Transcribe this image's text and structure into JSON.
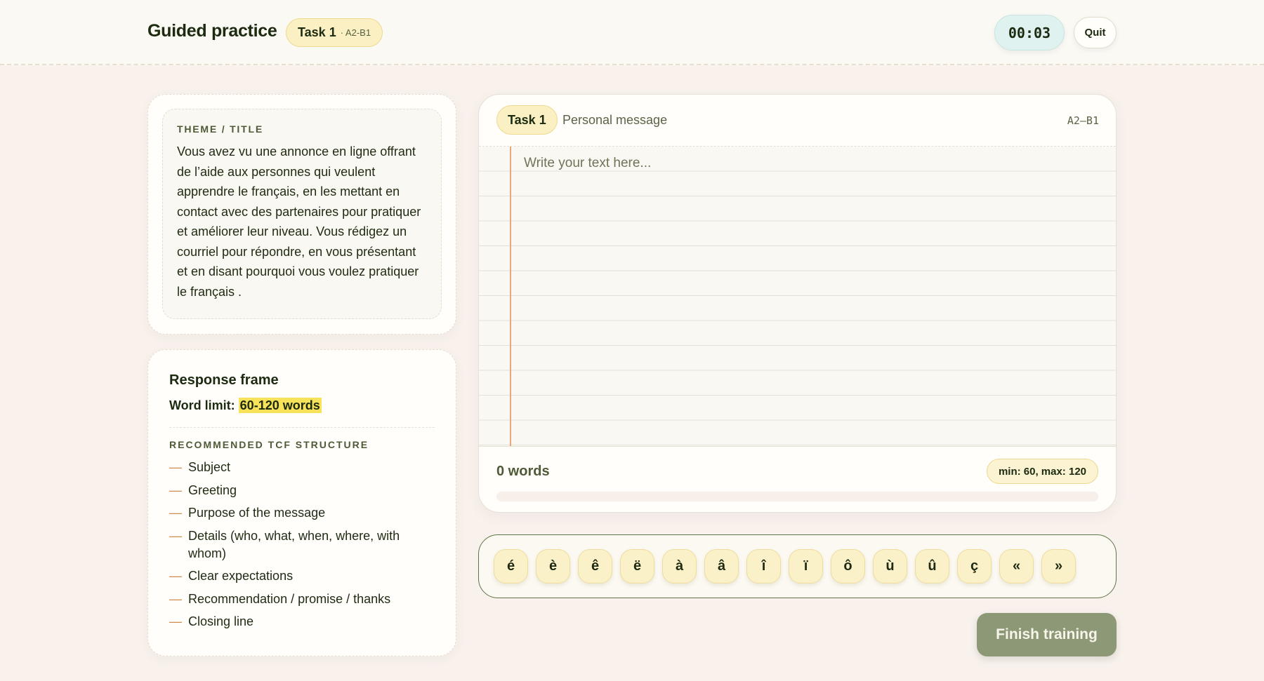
{
  "header": {
    "title": "Guided practice",
    "task_label": "Task 1",
    "level_label": "· A2-B1",
    "timer": "00:03",
    "quit_label": "Quit"
  },
  "theme": {
    "label": "THEME / TITLE",
    "text": "Vous avez vu une annonce en ligne offrant de l’aide aux personnes qui veulent apprendre le français, en les mettant en contact avec des partenaires pour pratiquer et améliorer leur niveau. Vous rédigez un courriel pour répondre, en vous présentant et en disant pourquoi vous voulez pratiquer le français ."
  },
  "frame": {
    "title": "Response frame",
    "limit_label": "Word limit:",
    "limit_value": "60-120 words",
    "structure_label": "RECOMMENDED TCF STRUCTURE",
    "dash": "—",
    "items": [
      "Subject",
      "Greeting",
      "Purpose of the message",
      "Details (who, what, when, where, with whom)",
      "Clear expectations",
      "Recommendation / promise / thanks",
      "Closing line"
    ]
  },
  "editor": {
    "task_label": "Task 1",
    "subtitle": "Personal message",
    "level": "A2–B1",
    "placeholder": "Write your text here...",
    "word_count": "0 words",
    "minmax": "min: 60, max: 120",
    "progress": 0
  },
  "accents": [
    "é",
    "è",
    "ê",
    "ë",
    "à",
    "â",
    "î",
    "ï",
    "ô",
    "ù",
    "û",
    "ç",
    "«",
    "»"
  ],
  "finish_label": "Finish training",
  "colors": {
    "accent_olive": "#8c9876",
    "highlight_yellow": "#f7e25a",
    "margin_orange": "#eaa77c",
    "timer_bg": "#dff2ef"
  }
}
